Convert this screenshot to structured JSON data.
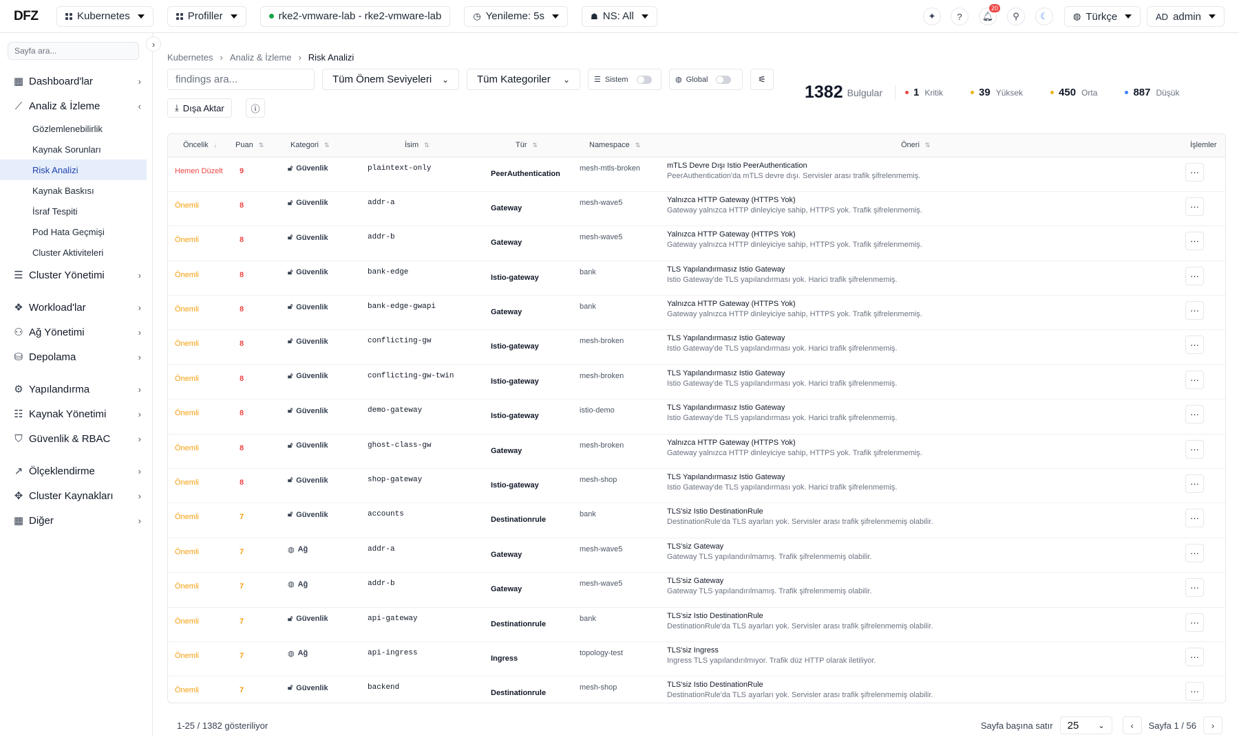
{
  "app": {
    "logo": "DFZ"
  },
  "topbar": {
    "kubernetes": "Kubernetes",
    "profiles": "Profiller",
    "cluster": "rke2-vmware-lab - rke2-vmware-lab",
    "refresh": "Yenileme: 5s",
    "namespace": "NS: All",
    "notifications_count": "20",
    "language": "Türkçe",
    "user_initials": "AD",
    "user_name": "admin"
  },
  "sidebar": {
    "search_placeholder": "Sayfa ara...",
    "items": [
      {
        "label": "Dashboard'lar",
        "icon": "dashboard-icon"
      },
      {
        "label": "Analiz & İzleme",
        "icon": "chart-line-icon",
        "expanded": true,
        "children": [
          "Gözlemlenebilirlik",
          "Kaynak Sorunları",
          "Risk Analizi",
          "Kaynak Baskısı",
          "İsraf Tespiti",
          "Pod Hata Geçmişi",
          "Cluster Aktiviteleri"
        ]
      },
      {
        "label": "Cluster Yönetimi",
        "icon": "server-icon"
      },
      {
        "label": "Workload'lar",
        "icon": "workload-icon"
      },
      {
        "label": "Ağ Yönetimi",
        "icon": "network-icon"
      },
      {
        "label": "Depolama",
        "icon": "database-icon"
      },
      {
        "label": "Yapılandırma",
        "icon": "gear-icon"
      },
      {
        "label": "Kaynak Yönetimi",
        "icon": "resource-icon"
      },
      {
        "label": "Güvenlik & RBAC",
        "icon": "shield-icon"
      },
      {
        "label": "Ölçeklendirme",
        "icon": "trending-up-icon"
      },
      {
        "label": "Cluster Kaynakları",
        "icon": "cluster-icon"
      },
      {
        "label": "Diğer",
        "icon": "grid-icon"
      }
    ],
    "active_child": "Risk Analizi"
  },
  "breadcrumb": [
    "Kubernetes",
    "Analiz & İzleme",
    "Risk Analizi"
  ],
  "filters": {
    "search_placeholder": "findings ara...",
    "severity": "Tüm Önem Seviyeleri",
    "category": "Tüm Kategoriler",
    "system": "Sistem",
    "global": "Global",
    "export": "Dışa Aktar"
  },
  "stats": {
    "total": "1382",
    "total_label": "Bulgular",
    "critical": "1",
    "critical_label": "Kritik",
    "high": "39",
    "high_label": "Yüksek",
    "medium": "450",
    "medium_label": "Orta",
    "low": "887",
    "low_label": "Düşük"
  },
  "table": {
    "headers": [
      "Öncelik",
      "Puan",
      "Kategori",
      "İsim",
      "Tür",
      "Namespace",
      "Öneri",
      "İşlemler"
    ],
    "rows": [
      {
        "priority": "Hemen Düzelt",
        "score": "9",
        "category": "Güvenlik",
        "name": "plaintext-only",
        "kind": "PeerAuthentication",
        "ns": "mesh-mtls-broken",
        "title": "mTLS Devre Dışı Istio PeerAuthentication",
        "desc": "PeerAuthentication'da mTLS devre dışı. Servisler arası trafik şifrelenmemiş."
      },
      {
        "priority": "Önemli",
        "score": "8",
        "category": "Güvenlik",
        "name": "addr-a",
        "kind": "Gateway",
        "ns": "mesh-wave5",
        "title": "Yalnızca HTTP Gateway (HTTPS Yok)",
        "desc": "Gateway yalnızca HTTP dinleyiciye sahip, HTTPS yok. Trafik şifrelenmemiş."
      },
      {
        "priority": "Önemli",
        "score": "8",
        "category": "Güvenlik",
        "name": "addr-b",
        "kind": "Gateway",
        "ns": "mesh-wave5",
        "title": "Yalnızca HTTP Gateway (HTTPS Yok)",
        "desc": "Gateway yalnızca HTTP dinleyiciye sahip, HTTPS yok. Trafik şifrelenmemiş."
      },
      {
        "priority": "Önemli",
        "score": "8",
        "category": "Güvenlik",
        "name": "bank-edge",
        "kind": "Istio-gateway",
        "ns": "bank",
        "title": "TLS Yapılandırmasız Istio Gateway",
        "desc": "Istio Gateway'de TLS yapılandırması yok. Harici trafik şifrelenmemiş."
      },
      {
        "priority": "Önemli",
        "score": "8",
        "category": "Güvenlik",
        "name": "bank-edge-gwapi",
        "kind": "Gateway",
        "ns": "bank",
        "title": "Yalnızca HTTP Gateway (HTTPS Yok)",
        "desc": "Gateway yalnızca HTTP dinleyiciye sahip, HTTPS yok. Trafik şifrelenmemiş."
      },
      {
        "priority": "Önemli",
        "score": "8",
        "category": "Güvenlik",
        "name": "conflicting-gw",
        "kind": "Istio-gateway",
        "ns": "mesh-broken",
        "title": "TLS Yapılandırmasız Istio Gateway",
        "desc": "Istio Gateway'de TLS yapılandırması yok. Harici trafik şifrelenmemiş."
      },
      {
        "priority": "Önemli",
        "score": "8",
        "category": "Güvenlik",
        "name": "conflicting-gw-twin",
        "kind": "Istio-gateway",
        "ns": "mesh-broken",
        "title": "TLS Yapılandırmasız Istio Gateway",
        "desc": "Istio Gateway'de TLS yapılandırması yok. Harici trafik şifrelenmemiş."
      },
      {
        "priority": "Önemli",
        "score": "8",
        "category": "Güvenlik",
        "name": "demo-gateway",
        "kind": "Istio-gateway",
        "ns": "istio-demo",
        "title": "TLS Yapılandırmasız Istio Gateway",
        "desc": "Istio Gateway'de TLS yapılandırması yok. Harici trafik şifrelenmemiş."
      },
      {
        "priority": "Önemli",
        "score": "8",
        "category": "Güvenlik",
        "name": "ghost-class-gw",
        "kind": "Gateway",
        "ns": "mesh-broken",
        "title": "Yalnızca HTTP Gateway (HTTPS Yok)",
        "desc": "Gateway yalnızca HTTP dinleyiciye sahip, HTTPS yok. Trafik şifrelenmemiş."
      },
      {
        "priority": "Önemli",
        "score": "8",
        "category": "Güvenlik",
        "name": "shop-gateway",
        "kind": "Istio-gateway",
        "ns": "mesh-shop",
        "title": "TLS Yapılandırmasız Istio Gateway",
        "desc": "Istio Gateway'de TLS yapılandırması yok. Harici trafik şifrelenmemiş."
      },
      {
        "priority": "Önemli",
        "score": "7",
        "category": "Güvenlik",
        "name": "accounts",
        "kind": "Destinationrule",
        "ns": "bank",
        "title": "TLS'siz Istio DestinationRule",
        "desc": "DestinationRule'da TLS ayarları yok. Servisler arası trafik şifrelenmemiş olabilir."
      },
      {
        "priority": "Önemli",
        "score": "7",
        "category": "Ağ",
        "name": "addr-a",
        "kind": "Gateway",
        "ns": "mesh-wave5",
        "title": "TLS'siz Gateway",
        "desc": "Gateway TLS yapılandırılmamış. Trafik şifrelenmemiş olabilir."
      },
      {
        "priority": "Önemli",
        "score": "7",
        "category": "Ağ",
        "name": "addr-b",
        "kind": "Gateway",
        "ns": "mesh-wave5",
        "title": "TLS'siz Gateway",
        "desc": "Gateway TLS yapılandırılmamış. Trafik şifrelenmemiş olabilir."
      },
      {
        "priority": "Önemli",
        "score": "7",
        "category": "Güvenlik",
        "name": "api-gateway",
        "kind": "Destinationrule",
        "ns": "bank",
        "title": "TLS'siz Istio DestinationRule",
        "desc": "DestinationRule'da TLS ayarları yok. Servisler arası trafik şifrelenmemiş olabilir."
      },
      {
        "priority": "Önemli",
        "score": "7",
        "category": "Ağ",
        "name": "api-ingress",
        "kind": "Ingress",
        "ns": "topology-test",
        "title": "TLS'siz Ingress",
        "desc": "Ingress TLS yapılandırılmıyor. Trafik düz HTTP olarak iletiliyor."
      },
      {
        "priority": "Önemli",
        "score": "7",
        "category": "Güvenlik",
        "name": "backend",
        "kind": "Destinationrule",
        "ns": "mesh-shop",
        "title": "TLS'siz Istio DestinationRule",
        "desc": "DestinationRule'da TLS ayarları yok. Servisler arası trafik şifrelenmemiş olabilir."
      }
    ]
  },
  "footer": {
    "showing": "1-25 / 1382 gösteriliyor",
    "rows_per_page_label": "Sayfa başına satır",
    "rows_per_page": "25",
    "page": "Sayfa 1 / 56"
  },
  "colors": {
    "critical": "#ef4444",
    "important": "#f59e0b",
    "high": "#eab308",
    "low": "#3b82f6",
    "active_bg": "#e6eefb"
  }
}
